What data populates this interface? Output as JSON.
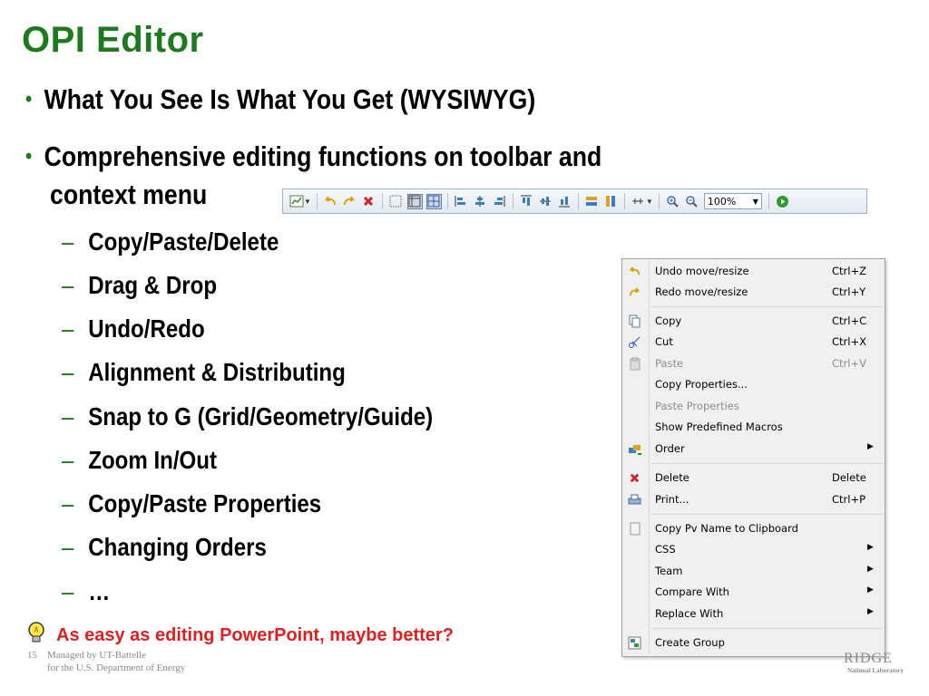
{
  "slide": {
    "title": "OPI Editor",
    "bullets": [
      "What You See Is What You Get (WYSIWYG)",
      "Comprehensive editing functions on toolbar and",
      "context menu"
    ],
    "sub_items": [
      "Copy/Paste/Delete",
      "Drag & Drop",
      "Undo/Redo",
      "Alignment & Distributing",
      "Snap to G (Grid/Geometry/Guide)",
      "Zoom In/Out",
      "Copy/Paste Properties",
      "Changing Orders",
      "…"
    ],
    "bullet_glyph": "•",
    "dash_glyph": "–",
    "tip": "As easy as editing PowerPoint, maybe better?",
    "accent_color": "#1f7a1f",
    "tip_color": "#e31e1e"
  },
  "toolbar": {
    "zoom_value": "100%",
    "icons": [
      "palette-icon",
      "undo-icon",
      "redo-icon",
      "delete-icon",
      "grid-icon",
      "ruler-icon",
      "guide-icon",
      "align-left-icon",
      "align-center-icon",
      "align-right-icon",
      "align-top-icon",
      "align-middle-icon",
      "align-bottom-icon",
      "match-width-icon",
      "match-height-icon",
      "distribute-icon",
      "zoom-in-icon",
      "zoom-out-icon",
      "run-icon"
    ]
  },
  "context_menu": {
    "items": [
      {
        "label": "Undo move/resize",
        "accel": "Ctrl+Z",
        "icon": "undo-icon"
      },
      {
        "label": "Redo move/resize",
        "accel": "Ctrl+Y",
        "icon": "redo-icon"
      },
      {
        "label": "Copy",
        "accel": "Ctrl+C",
        "icon": "copy-icon"
      },
      {
        "label": "Cut",
        "accel": "Ctrl+X",
        "icon": "cut-icon"
      },
      {
        "label": "Paste",
        "accel": "Ctrl+V",
        "icon": "paste-icon",
        "disabled": true
      },
      {
        "label": "Copy Properties...",
        "accel": ""
      },
      {
        "label": "Paste Properties",
        "accel": "",
        "disabled": true
      },
      {
        "label": "Show Predefined Macros",
        "accel": ""
      },
      {
        "label": "Order",
        "accel": "",
        "icon": "order-icon",
        "submenu": true
      },
      {
        "label": "Delete",
        "accel": "Delete",
        "icon": "delete-icon"
      },
      {
        "label": "Print...",
        "accel": "Ctrl+P",
        "icon": "print-icon"
      },
      {
        "label": "Copy Pv Name to Clipboard",
        "accel": "",
        "icon": "clipboard-icon"
      },
      {
        "label": "CSS",
        "accel": "",
        "submenu": true
      },
      {
        "label": "Team",
        "accel": "",
        "submenu": true
      },
      {
        "label": "Compare With",
        "accel": "",
        "submenu": true
      },
      {
        "label": "Replace With",
        "accel": "",
        "submenu": true
      },
      {
        "label": "Create Group",
        "accel": "",
        "icon": "group-icon"
      }
    ],
    "submenu_arrow": "▶"
  },
  "footer": {
    "page_number": "15",
    "line1": "Managed by UT-Battelle",
    "line2": "for the U.S. Department of Energy",
    "logo_text": "RIDGE",
    "logo_sub": "National Laboratory"
  }
}
